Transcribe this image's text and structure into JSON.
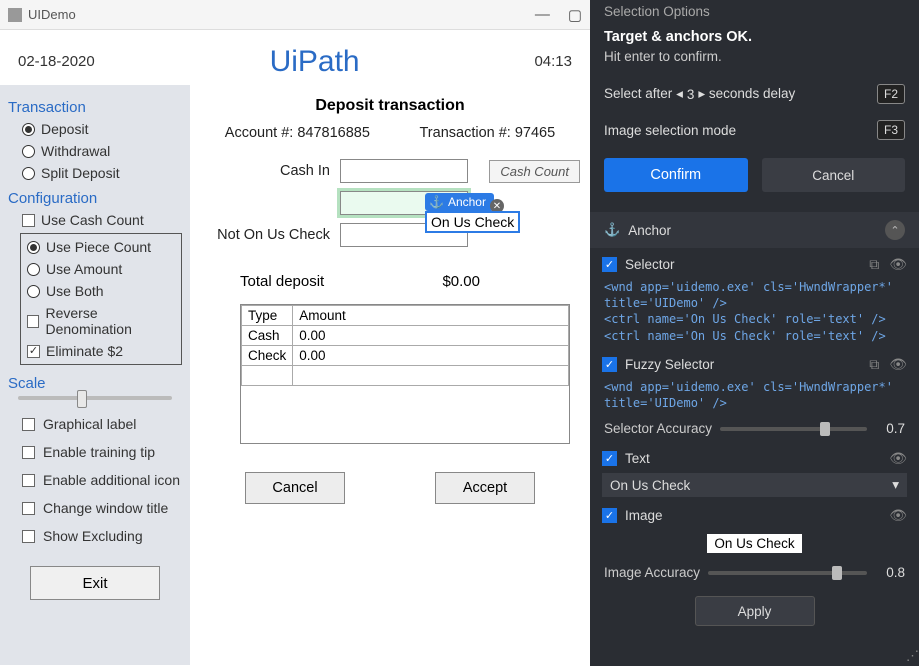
{
  "titlebar": {
    "title": "UIDemo"
  },
  "header": {
    "date": "02-18-2020",
    "brand": "UiPath",
    "time": "04:13"
  },
  "sidebar": {
    "transaction_h": "Transaction",
    "tx_deposit": "Deposit",
    "tx_withdrawal": "Withdrawal",
    "tx_split": "Split Deposit",
    "config_h": "Configuration",
    "use_cash_count": "Use Cash Count",
    "use_piece": "Use Piece Count",
    "use_amount": "Use Amount",
    "use_both": "Use Both",
    "reverse_denom": "Reverse Denomination",
    "eliminate2": "Eliminate $2",
    "scale_h": "Scale",
    "opt_graphical": "Graphical label",
    "opt_training": "Enable training tip",
    "opt_icon": "Enable additional icon",
    "opt_title": "Change window title",
    "opt_excluding": "Show Excluding",
    "exit": "Exit"
  },
  "main": {
    "heading": "Deposit transaction",
    "account_label": "Account #: 847816885",
    "trans_label": "Transaction #: 97465",
    "cash_in": "Cash In",
    "on_us": "On Us Check",
    "not_on_us": "Not On Us Check",
    "cash_count_btn": "Cash Count",
    "anchor_tag": "Anchor",
    "total_label": "Total deposit",
    "total_value": "$0.00",
    "col_type": "Type",
    "col_amount": "Amount",
    "rows": [
      {
        "type": "Cash",
        "amount": "0.00"
      },
      {
        "type": "Check",
        "amount": "0.00"
      }
    ],
    "cancel": "Cancel",
    "accept": "Accept"
  },
  "panel": {
    "title": "Selection Options",
    "status1": "Target & anchors OK.",
    "status2": "Hit enter to confirm.",
    "select_after_pre": "Select after",
    "select_after_val": "3",
    "select_after_post": "seconds delay",
    "select_after_key": "F2",
    "img_mode": "Image selection mode",
    "img_mode_key": "F3",
    "confirm": "Confirm",
    "cancel": "Cancel",
    "anchor_h": "Anchor",
    "selector_h": "Selector",
    "selector_code": "<wnd app='uidemo.exe' cls='HwndWrapper*' title='UIDemo' />\n<ctrl name='On Us Check' role='text' />\n<ctrl name='On Us Check' role='text' />",
    "fuzzy_h": "Fuzzy Selector",
    "fuzzy_code": "<wnd app='uidemo.exe' cls='HwndWrapper*' title='UIDemo' />",
    "accuracy_lab": "Selector Accuracy",
    "accuracy_val": "0.7",
    "text_h": "Text",
    "text_value": "On Us Check",
    "image_h": "Image",
    "image_preview": "On Us Check",
    "img_accuracy_lab": "Image Accuracy",
    "img_accuracy_val": "0.8",
    "apply": "Apply"
  }
}
